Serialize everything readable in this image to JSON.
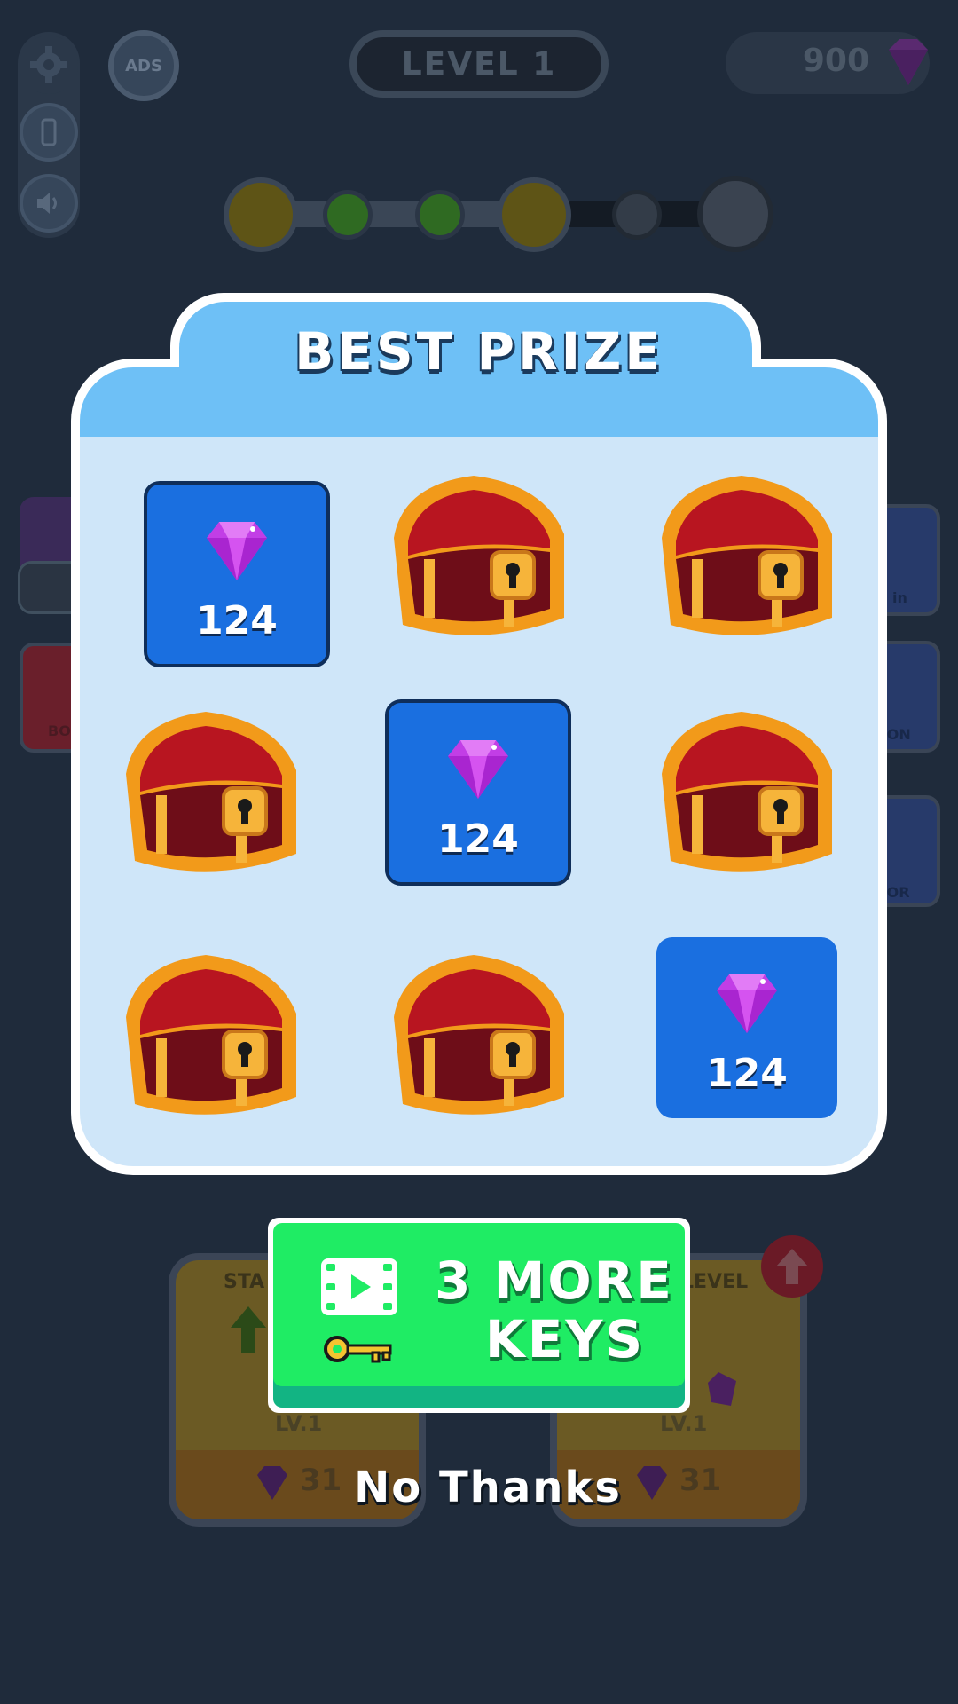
{
  "header": {
    "level_label": "LEVEL 1",
    "gem_count": "900",
    "ads_label": "ADS"
  },
  "background_cards": {
    "left": {
      "title_fragment": "STA",
      "level": "LV.1",
      "price": "31"
    },
    "right": {
      "title_fragment": "LEVEL",
      "level": "LV.1",
      "price": "31"
    },
    "side_labels": [
      "BO",
      "in",
      "PON",
      "LOR"
    ]
  },
  "modal": {
    "title": "BEST PRIZE",
    "grid": [
      {
        "kind": "gem",
        "value": "124"
      },
      {
        "kind": "chest"
      },
      {
        "kind": "chest"
      },
      {
        "kind": "chest"
      },
      {
        "kind": "gem",
        "value": "124"
      },
      {
        "kind": "chest"
      },
      {
        "kind": "chest"
      },
      {
        "kind": "chest"
      },
      {
        "kind": "gem",
        "value": "124"
      }
    ]
  },
  "cta": {
    "line1": "3 MORE",
    "line2": "KEYS",
    "icons": [
      "video-play-icon",
      "key-icon"
    ]
  },
  "dismiss_label": "No Thanks",
  "colors": {
    "background": "#1f2b3b",
    "modal_header": "#6ec0f6",
    "modal_inner": "#cfe6f9",
    "gem_tile": "#1a6fe0",
    "cta_green": "#1fec64",
    "gem_purple": "#c23ee6"
  }
}
